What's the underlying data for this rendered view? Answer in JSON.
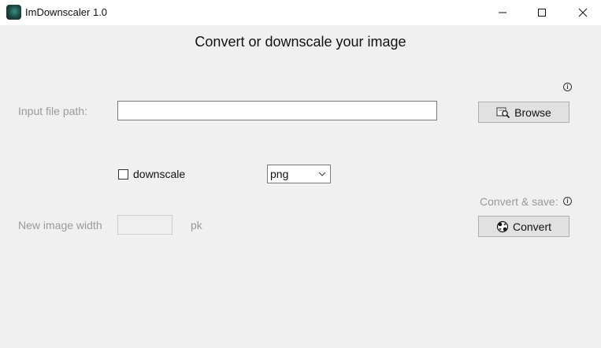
{
  "window": {
    "title": "ImDownscaler 1.0",
    "icon": "app-icon",
    "controls": [
      "minimize-icon",
      "maximize-icon",
      "close-icon"
    ]
  },
  "main": {
    "heading": "Convert or downscale your image",
    "input_label": "Input file path:",
    "input_value": "",
    "browse_label": "Browse",
    "browse_icon": "browse-search-icon",
    "downscale_label": "downscale",
    "downscale_checked": false,
    "format_selected": "png",
    "convert_save_label": "Convert & save:",
    "width_label": "New image width",
    "width_value": "",
    "width_unit": "pk",
    "convert_label": "Convert",
    "convert_icon": "convert-icon",
    "info_icon_glyph": "i"
  },
  "colors": {
    "background": "#f0f0f0",
    "titlebar": "#ffffff",
    "muted_text": "#9a9a9a",
    "button": "#e1e1e1"
  }
}
